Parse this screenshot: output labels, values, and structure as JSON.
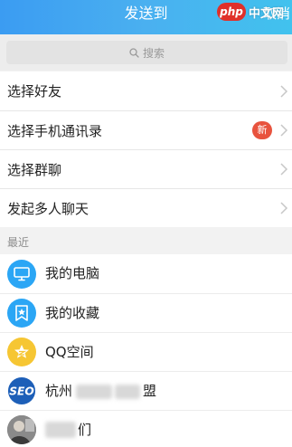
{
  "header": {
    "title": "发送到",
    "cancel_label": "取消",
    "watermark_php": "php",
    "watermark_text": "中文网"
  },
  "search": {
    "placeholder": "搜索"
  },
  "menu": {
    "items": [
      {
        "label": "选择好友"
      },
      {
        "label": "选择手机通讯录",
        "badge": "新"
      },
      {
        "label": "选择群聊"
      },
      {
        "label": "发起多人聊天"
      }
    ]
  },
  "recent": {
    "section_label": "最近",
    "items": [
      {
        "name": "我的电脑",
        "icon": "computer-icon",
        "color": "#2ba6f5"
      },
      {
        "name": "我的收藏",
        "icon": "favorite-icon",
        "color": "#2ba6f5"
      },
      {
        "name": "QQ空间",
        "icon": "qzone-star-icon",
        "color": "#f6c633"
      },
      {
        "name_part1": "杭州",
        "name_part2": "盟",
        "icon": "seo-avatar-icon",
        "color": "#1d5fb8"
      },
      {
        "name_part1": "",
        "name_part2": "们",
        "icon": "photo-avatar-icon",
        "color": "#6b6b6b"
      }
    ]
  },
  "colors": {
    "header_gradient_start": "#3b9cf2",
    "header_gradient_end": "#41c2ee",
    "badge_red": "#e8533e"
  }
}
